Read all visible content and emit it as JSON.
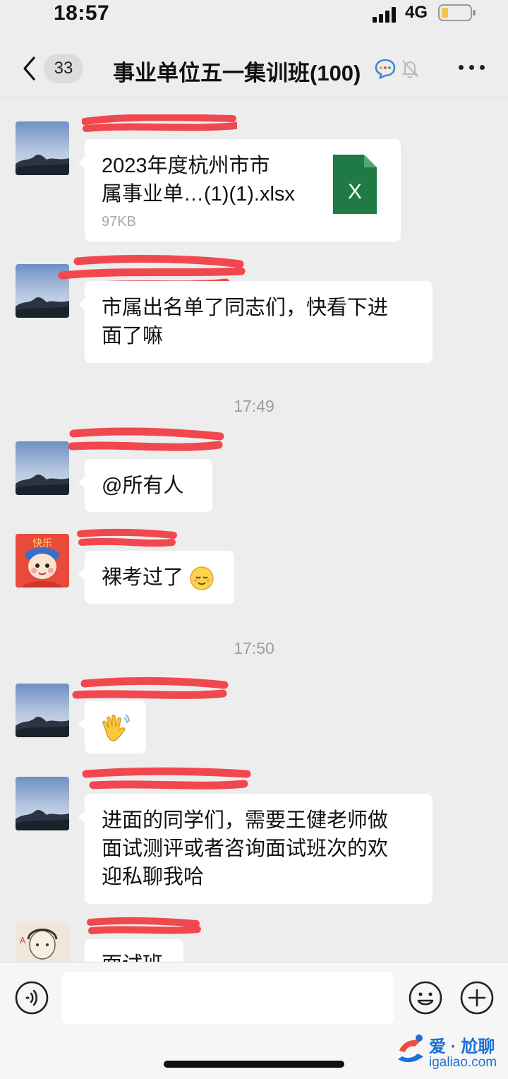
{
  "status_bar": {
    "time": "18:57",
    "network": "4G",
    "battery_level": 0.22
  },
  "nav": {
    "unread_count": "33",
    "title": "事业单位五一集训班(100)",
    "icons": [
      "back-chevron-icon",
      "group-chat-icon",
      "mute-bell-icon",
      "more-icon"
    ]
  },
  "messages": [
    {
      "type": "file",
      "avatar": "landscape-avatar",
      "file_name": "2023年度杭州市市属事业单…(1)(1).xlsx",
      "file_name_line1": "2023年度杭州市市",
      "file_name_line2": "属事业单…(1)(1).xlsx",
      "file_size": "97KB",
      "file_icon": "X"
    },
    {
      "type": "text",
      "avatar": "landscape-avatar",
      "line1": "市属出名单了同志们，快看下进",
      "line2": "面了嘛"
    },
    {
      "type": "time",
      "text": "17:49"
    },
    {
      "type": "text",
      "avatar": "landscape-avatar",
      "line1": "@所有人"
    },
    {
      "type": "text",
      "avatar": "cartoon-avatar",
      "avatar_text": "快乐",
      "line1": "裸考过了",
      "emoji": "relieved-face-emoji"
    },
    {
      "type": "time",
      "text": "17:50"
    },
    {
      "type": "emoji",
      "avatar": "landscape-avatar",
      "emoji": "waving-hand-emoji"
    },
    {
      "type": "text",
      "avatar": "landscape-avatar",
      "line1": "进面的同学们，需要王健老师做",
      "line2": "面试测评或者咨询面试班次的欢",
      "line3": "迎私聊我哈"
    },
    {
      "type": "text",
      "avatar": "sketch-avatar",
      "line1": "面试班"
    }
  ],
  "input_bar": {
    "icons": [
      "voice-icon",
      "emoji-icon",
      "plus-icon"
    ],
    "value": ""
  },
  "watermark": {
    "text": "爱 · 尬聊",
    "url": "igaliao.com"
  },
  "colors": {
    "background": "#ededed",
    "bubble": "#ffffff",
    "redaction": "#f0484e",
    "excel_green": "#1f7a45",
    "time_text": "#9c9c9c"
  }
}
